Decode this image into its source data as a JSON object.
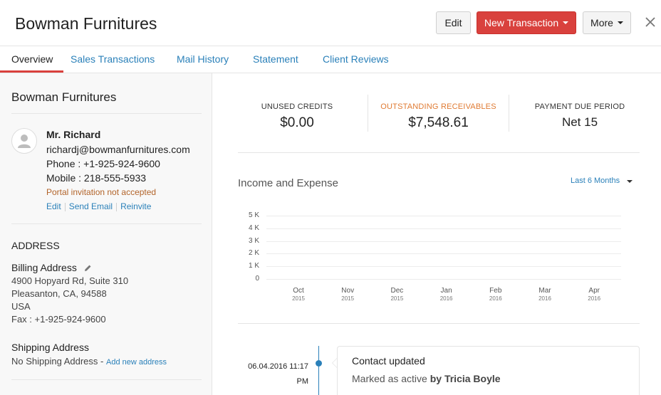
{
  "header": {
    "title": "Bowman Furnitures",
    "edit_label": "Edit",
    "new_transaction_label": "New Transaction",
    "more_label": "More",
    "accent_color": "#d9413d"
  },
  "tabs": [
    {
      "label": "Overview",
      "active": true
    },
    {
      "label": "Sales Transactions",
      "active": false
    },
    {
      "label": "Mail History",
      "active": false
    },
    {
      "label": "Statement",
      "active": false
    },
    {
      "label": "Client Reviews",
      "active": false
    }
  ],
  "sidebar": {
    "company_name": "Bowman Furnitures",
    "contact": {
      "name": "Mr. Richard",
      "email": "richardj@bowmanfurnitures.com",
      "phone": "Phone : +1-925-924-9600",
      "mobile": "Mobile : 218-555-5933",
      "portal_status": "Portal invitation not accepted",
      "actions": [
        "Edit",
        "Send Email",
        "Reinvite"
      ]
    },
    "address_heading": "ADDRESS",
    "billing": {
      "heading": "Billing Address",
      "lines": [
        "4900 Hopyard Rd, Suite 310",
        "Pleasanton, CA, 94588",
        "USA",
        "Fax : +1-925-924-9600"
      ]
    },
    "shipping": {
      "heading": "Shipping Address",
      "none_text": "No Shipping Address -",
      "add_link": "Add new address"
    }
  },
  "stats": [
    {
      "label": "UNUSED CREDITS",
      "value": "$0.00"
    },
    {
      "label": "OUTSTANDING RECEIVABLES",
      "value": "$7,548.61"
    },
    {
      "label": "PAYMENT DUE PERIOD",
      "value": "Net 15"
    }
  ],
  "chart_section": {
    "title": "Income and Expense",
    "period": "Last 6 Months"
  },
  "chart_data": {
    "type": "bar",
    "title": "",
    "y_ticks": [
      "5 K",
      "4 K",
      "3 K",
      "2 K",
      "1 K",
      "0"
    ],
    "categories": [
      {
        "month": "Oct",
        "year": "2015"
      },
      {
        "month": "Nov",
        "year": "2015"
      },
      {
        "month": "Dec",
        "year": "2015"
      },
      {
        "month": "Jan",
        "year": "2016"
      },
      {
        "month": "Feb",
        "year": "2016"
      },
      {
        "month": "Mar",
        "year": "2016"
      },
      {
        "month": "Apr",
        "year": "2016"
      }
    ],
    "values": [
      0,
      0,
      0,
      0,
      0,
      0,
      0
    ],
    "ylim": [
      0,
      5000
    ],
    "grid": true
  },
  "timeline": {
    "date": "06.04.2016 11:17",
    "time_suffix": "PM",
    "title": "Contact updated",
    "desc_prefix": "Marked as active",
    "desc_by": "by Tricia Boyle"
  }
}
